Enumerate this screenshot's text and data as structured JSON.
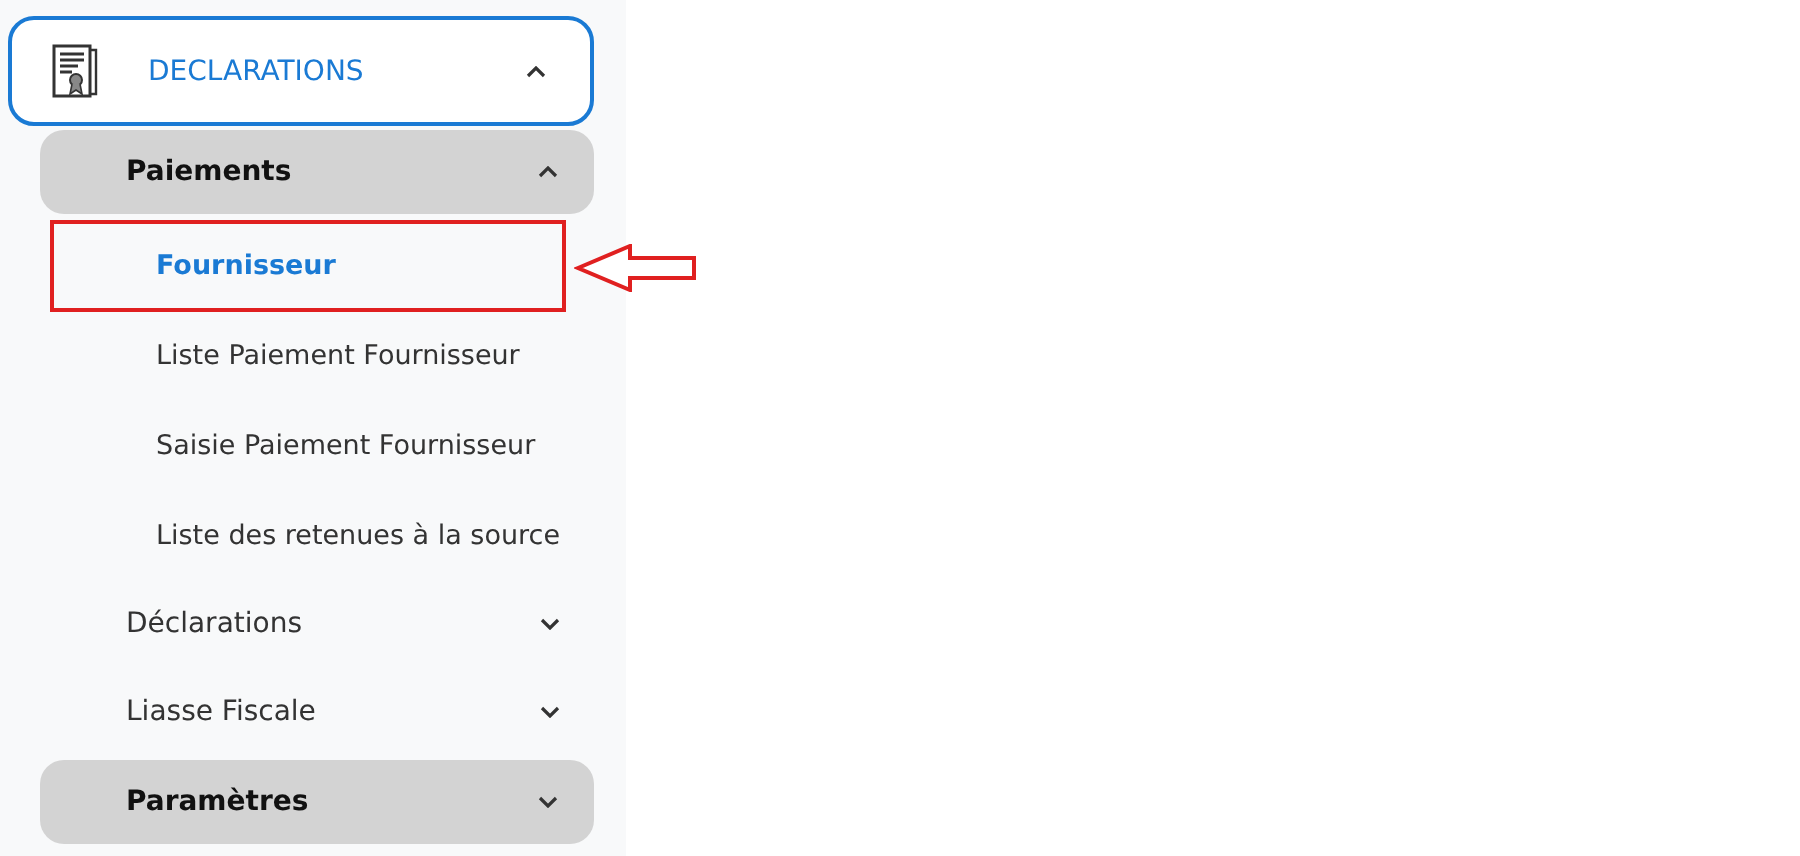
{
  "sidebar": {
    "items": [
      {
        "label": "DECLARATIONS",
        "expanded": true,
        "children": [
          {
            "label": "Paiements",
            "kind": "group",
            "expanded": true,
            "children": [
              {
                "label": "Fournisseur",
                "selected": true,
                "marked": true
              },
              {
                "label": "Liste Paiement Fournisseur",
                "selected": false,
                "marked": false
              },
              {
                "label": "Saisie Paiement Fournisseur",
                "selected": false,
                "marked": false
              },
              {
                "label": "Liste des retenues à la source",
                "selected": false,
                "marked": false
              }
            ]
          },
          {
            "label": "Déclarations",
            "kind": "submenu",
            "expanded": false
          },
          {
            "label": "Liasse Fiscale",
            "kind": "submenu",
            "expanded": false
          },
          {
            "label": "Paramètres",
            "kind": "group",
            "expanded": false
          }
        ]
      }
    ]
  }
}
